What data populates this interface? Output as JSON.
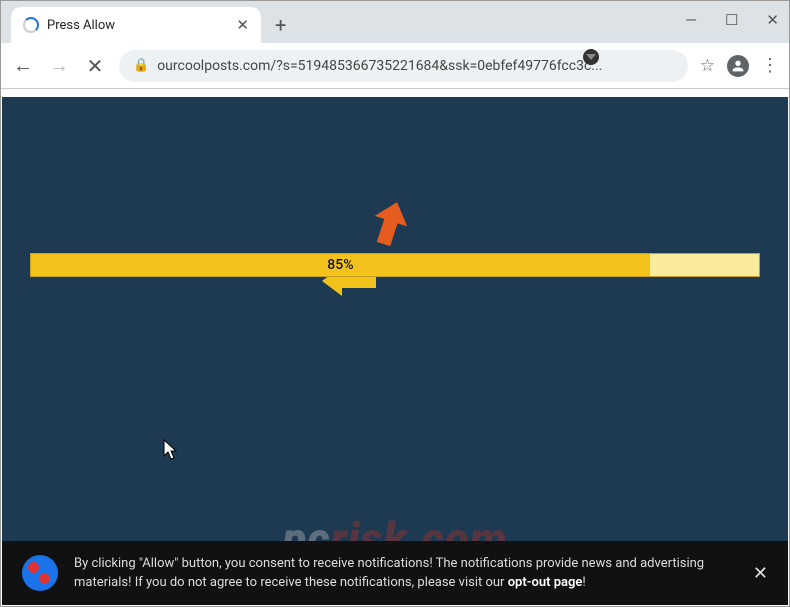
{
  "tab": {
    "title": "Press Allow"
  },
  "url": "ourcoolposts.com/?s=519485366735221684&ssk=0ebfef49776fcc3c...",
  "progress": {
    "percent_label": "85%",
    "value": 85
  },
  "notification": {
    "text_1": "By clicking \"Allow\" button, you consent to receive notifications! The notifications provide news and advertising materials! If you do not agree to receive these notifications, please visit our ",
    "link": "opt-out page",
    "text_2": "!"
  },
  "watermark": {
    "prefix": "pc",
    "suffix": "risk.com"
  },
  "icons": {
    "tab_close": "✕",
    "new_tab": "+",
    "back": "←",
    "forward": "→",
    "stop": "✕",
    "lock": "🔒",
    "star": "☆",
    "menu": "⋮",
    "minimize": "—",
    "maximize": "☐",
    "close": "✕",
    "notif_close": "✕"
  }
}
